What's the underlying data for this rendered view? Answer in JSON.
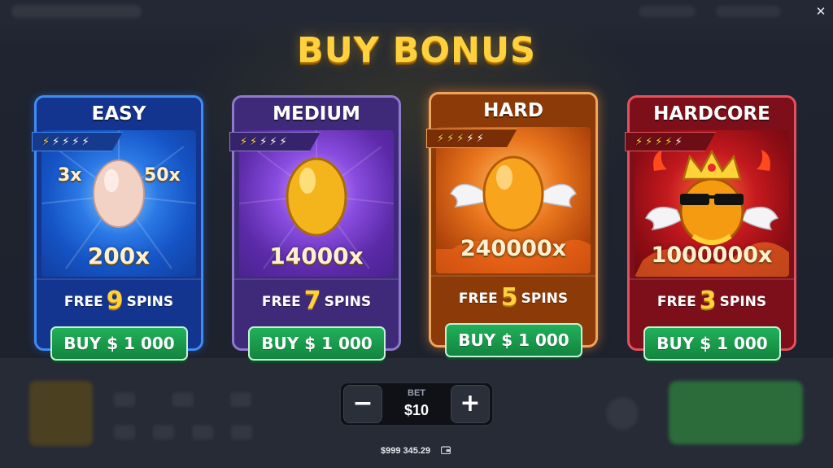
{
  "dialog": {
    "title": "BUY BONUS",
    "close_icon": "close-icon"
  },
  "cards": [
    {
      "name": "EASY",
      "bolts_filled": 1,
      "bolts_total": 5,
      "multipliers": [
        "3x",
        "50x",
        "200x"
      ],
      "free_label": "FREE",
      "spins_count": "9",
      "spins_label": "SPINS",
      "buy_label": "BUY $ 1 000",
      "accent": "#3e8cf4"
    },
    {
      "name": "MEDIUM",
      "bolts_filled": 2,
      "bolts_total": 5,
      "multipliers": [
        "14000x"
      ],
      "free_label": "FREE",
      "spins_count": "7",
      "spins_label": "SPINS",
      "buy_label": "BUY $ 1 000",
      "accent": "#8e7acc"
    },
    {
      "name": "HARD",
      "bolts_filled": 3,
      "bolts_total": 5,
      "multipliers": [
        "240000x"
      ],
      "free_label": "FREE",
      "spins_count": "5",
      "spins_label": "SPINS",
      "buy_label": "BUY $ 1 000",
      "accent": "#f0a35a"
    },
    {
      "name": "HARDCORE",
      "bolts_filled": 4,
      "bolts_total": 5,
      "multipliers": [
        "1000000x"
      ],
      "free_label": "FREE",
      "spins_count": "3",
      "spins_label": "SPINS",
      "buy_label": "BUY $ 1 000",
      "accent": "#e2525e"
    }
  ],
  "bet": {
    "label": "BET",
    "value": "$10",
    "minus": "−",
    "plus": "+"
  },
  "balance": {
    "amount": "$999 345.29",
    "icon": "wallet-icon"
  },
  "colors": {
    "title_gold": "#ffd23d",
    "buy_green": "#21b05a"
  }
}
